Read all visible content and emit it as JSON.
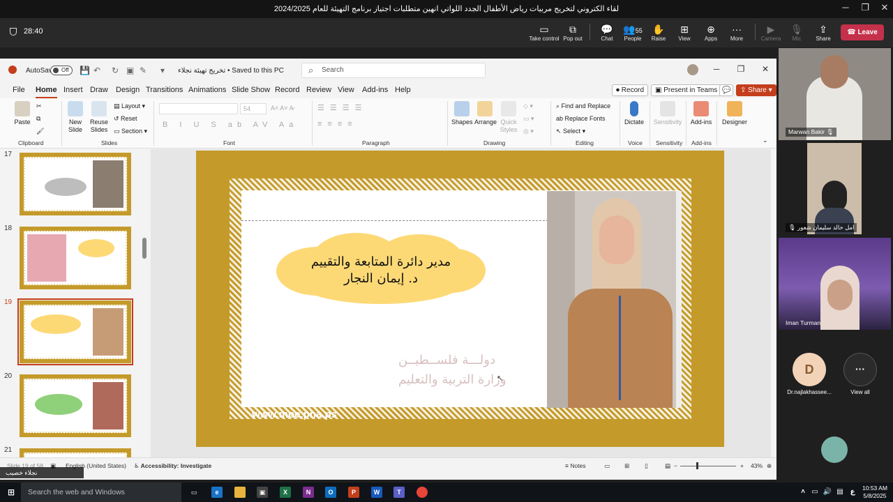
{
  "teams": {
    "window_title": "لقاء الكتروني لتخريج مربيات رياض الأطفال الجدد اللواتي انهين متطلبات اجتياز برنامج التهيئة للعام 2024/2025",
    "timer": "28:40",
    "tools": {
      "take_control": "Take control",
      "pop_out": "Pop out",
      "chat": "Chat",
      "people": "People",
      "people_count": "55",
      "raise": "Raise",
      "view": "View",
      "apps": "Apps",
      "more": "More",
      "camera": "Camera",
      "mic": "Mic",
      "share": "Share",
      "leave": "Leave"
    },
    "participants": [
      {
        "name": "Marwan Bakir"
      },
      {
        "name": "امل خالد سليمان شعور"
      },
      {
        "name": "Iman Turman"
      },
      {
        "name": "Dr.najlakhassee...",
        "initial": "D"
      },
      {
        "name": "View all"
      }
    ],
    "presenter_label": "نجلاء خصيب"
  },
  "ppt": {
    "autosave_label": "AutoSave",
    "autosave_state": "Off",
    "doc_name": "تخريج تهيئة نجلاء • Saved to this PC",
    "search_placeholder": "Search",
    "tabs": [
      "File",
      "Home",
      "Insert",
      "Draw",
      "Design",
      "Transitions",
      "Animations",
      "Slide Show",
      "Record",
      "Review",
      "View",
      "Add-ins",
      "Help"
    ],
    "active_tab": "Home",
    "record_btn": "Record",
    "present_btn": "Present in Teams",
    "share_btn": "Share",
    "ribbon": {
      "paste": "Paste",
      "clipboard": "Clipboard",
      "new_slide": "New Slide",
      "reuse_slides": "Reuse Slides",
      "layout": "Layout",
      "reset": "Reset",
      "section": "Section",
      "slides": "Slides",
      "font": "Font",
      "paragraph": "Paragraph",
      "shapes": "Shapes",
      "arrange": "Arrange",
      "quick_styles": "Quick Styles",
      "drawing": "Drawing",
      "find_replace": "Find and Replace",
      "replace_fonts": "Replace Fonts",
      "select": "Select",
      "editing": "Editing",
      "dictate": "Dictate",
      "voice": "Voice",
      "sensitivity": "Sensitivity",
      "sensitivity_group": "Sensitivity",
      "addins": "Add-ins",
      "addins_group": "Add-ins",
      "designer": "Designer",
      "font_size": "54"
    },
    "thumbnails": [
      {
        "num": "17"
      },
      {
        "num": "18"
      },
      {
        "num": "19",
        "selected": true
      },
      {
        "num": "20"
      },
      {
        "num": "21"
      }
    ],
    "slide": {
      "title_line1": "مدير دائرة المتابعة والتقييم",
      "title_line2": "د. إيمان النجار",
      "watermark_line1": "دولـــة فلســطيــن",
      "watermark_line2": "وزارة التربية والتعليم",
      "url": "www.moe.pna.ps"
    },
    "status": {
      "slide_of": "Slide 19 of 58",
      "language": "English (United States)",
      "accessibility": "Accessibility: Investigate",
      "notes": "Notes",
      "zoom": "43%"
    }
  },
  "taskbar": {
    "search_placeholder": "Search the web and Windows",
    "time": "10:53 AM",
    "date": "5/8/2025"
  }
}
